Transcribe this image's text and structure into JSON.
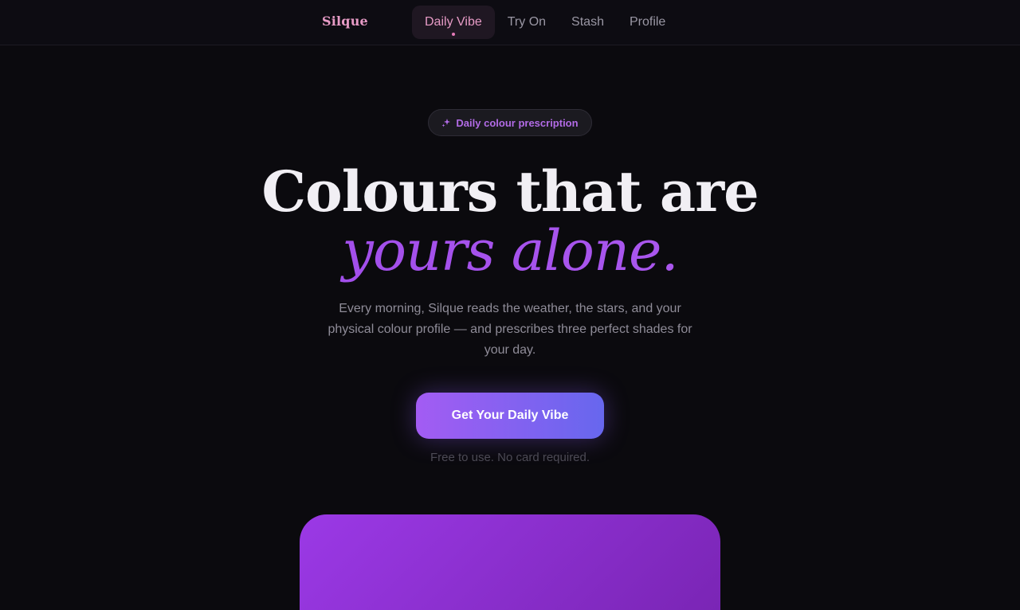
{
  "brand": {
    "name": "Silque"
  },
  "nav": {
    "items": [
      {
        "label": "Daily Vibe",
        "active": true
      },
      {
        "label": "Try On",
        "active": false
      },
      {
        "label": "Stash",
        "active": false
      },
      {
        "label": "Profile",
        "active": false
      }
    ]
  },
  "hero": {
    "badge": {
      "icon": "sparkle-icon",
      "label": "Daily colour prescription"
    },
    "headline_line1": "Colours that are",
    "headline_line2": "yours alone.",
    "lead": "Every morning, Silque reads the weather, the stars, and your physical colour profile — and prescribes three perfect shades for your day.",
    "cta_label": "Get Your Daily Vibe",
    "note": "Free to use. No card required."
  },
  "colors": {
    "background": "#0b0a0e",
    "brand_pink": "#e79bc6",
    "accent_purple": "#9b47e8",
    "cta_gradient_start": "#a35cf3",
    "cta_gradient_end": "#6767ee"
  }
}
